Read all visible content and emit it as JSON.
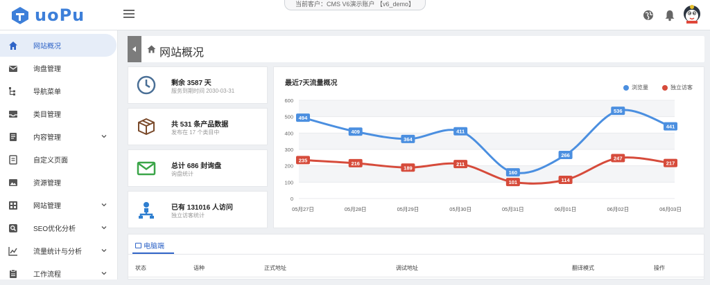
{
  "app": {
    "logo_text": "uoPu",
    "customer": "当前客户：CMS V6演示账户 【v6_demo】"
  },
  "header": {
    "icons": [
      "globe-icon",
      "bell-icon",
      "avatar"
    ]
  },
  "sidebar": {
    "items": [
      {
        "label": "网站概况",
        "icon": "home-icon",
        "active": true,
        "expandable": false
      },
      {
        "label": "询盘管理",
        "icon": "mail-icon",
        "expandable": false
      },
      {
        "label": "导航菜单",
        "icon": "tree-icon",
        "expandable": false
      },
      {
        "label": "类目管理",
        "icon": "inbox-icon",
        "expandable": false
      },
      {
        "label": "内容管理",
        "icon": "document-icon",
        "expandable": true
      },
      {
        "label": "自定义页面",
        "icon": "page-icon",
        "expandable": false
      },
      {
        "label": "资源管理",
        "icon": "image-icon",
        "expandable": false
      },
      {
        "label": "网站管理",
        "icon": "grid-icon",
        "expandable": true
      },
      {
        "label": "SEO优化分析",
        "icon": "search-icon",
        "expandable": true
      },
      {
        "label": "流量统计与分析",
        "icon": "trend-icon",
        "expandable": true
      },
      {
        "label": "工作流程",
        "icon": "clipboard-icon",
        "expandable": true
      }
    ]
  },
  "page": {
    "title": "网站概况"
  },
  "stats": [
    {
      "main": "剩余 3587 天",
      "sub": "服务到期时间 2030-03-31",
      "icon": "clock-icon",
      "color": "#4a6f96"
    },
    {
      "main": "共 531 条产品数据",
      "sub": "发布在 17 个类目中",
      "icon": "box-icon",
      "color": "#7a4a2b"
    },
    {
      "main": "总计 686 封询盘",
      "sub": "询盘统计",
      "icon": "envelope-icon",
      "color": "#3aa548"
    },
    {
      "main": "已有 131016 人访问",
      "sub": "独立访客统计",
      "icon": "sitemap-icon",
      "color": "#2f7fd0"
    }
  ],
  "chart_data": {
    "type": "line",
    "title": "最近7天流量概况",
    "categories": [
      "05月27日",
      "05月28日",
      "05月29日",
      "05月30日",
      "05月31日",
      "06月01日",
      "06月02日",
      "06月03日"
    ],
    "series": [
      {
        "name": "浏览量",
        "values": [
          494,
          409,
          364,
          411,
          160,
          266,
          536,
          441
        ],
        "color": "#4b8fe0"
      },
      {
        "name": "独立访客",
        "values": [
          235,
          216,
          189,
          211,
          101,
          114,
          247,
          217
        ],
        "color": "#d64b3b"
      }
    ],
    "y_ticks": [
      "0",
      "100",
      "200",
      "300",
      "400",
      "500",
      "600"
    ],
    "ylim": [
      0,
      600
    ],
    "grid": true,
    "legend": "top-right"
  },
  "table": {
    "tab_label": "电脑端",
    "columns": [
      "状态",
      "语种",
      "正式地址",
      "调试地址",
      "翻译模式",
      "操作"
    ]
  }
}
